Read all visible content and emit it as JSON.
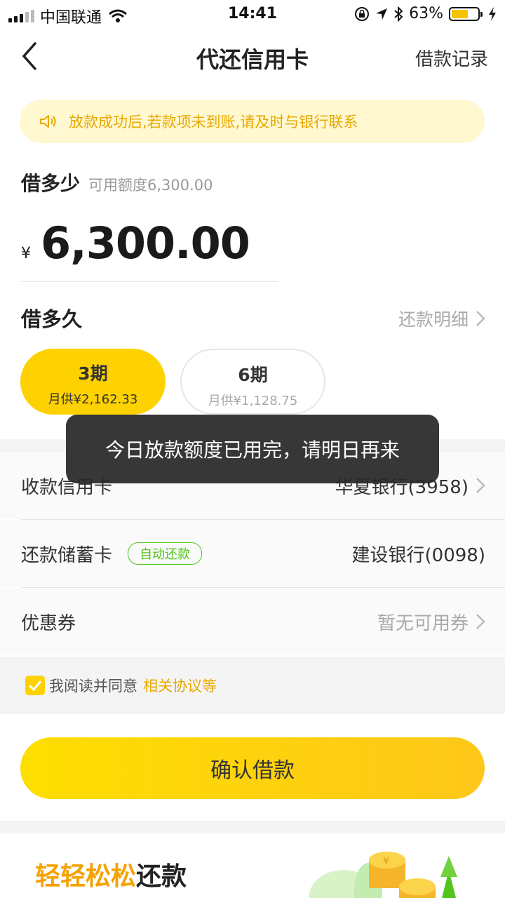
{
  "status_bar": {
    "carrier": "中国联通",
    "time": "14:41",
    "battery": "63%",
    "battery_level": 0.63
  },
  "nav": {
    "title": "代还信用卡",
    "record": "借款记录"
  },
  "notice": {
    "text": "放款成功后,若款项未到账,请及时与银行联系"
  },
  "amount": {
    "label": "借多少",
    "available": "可用额度6,300.00",
    "currency": "¥",
    "value": "6,300.00"
  },
  "term": {
    "label": "借多久",
    "detail": "还款明细",
    "plans": [
      {
        "period": "3期",
        "monthly": "月供¥2,162.33",
        "selected": true
      },
      {
        "period": "6期",
        "monthly": "月供¥1,128.75",
        "selected": false
      }
    ]
  },
  "rows": {
    "credit_card": {
      "label": "收款信用卡",
      "value": "华夏银行(3958)"
    },
    "debit_card": {
      "label": "还款储蓄卡",
      "tag": "自动还款",
      "value": "建设银行(0098)"
    },
    "coupon": {
      "label": "优惠券",
      "value": "暂无可用券"
    }
  },
  "agreement": {
    "text": "我阅读并同意",
    "link": "相关协议等",
    "checked": true
  },
  "confirm": {
    "label": "确认借款"
  },
  "promo": {
    "highlight": "轻轻松松",
    "rest": "还款"
  },
  "toast": {
    "text": "今日放款额度已用完，请明日再来"
  },
  "colors": {
    "accent": "#fed200",
    "link": "#e8a800",
    "tag": "#52c41a"
  }
}
